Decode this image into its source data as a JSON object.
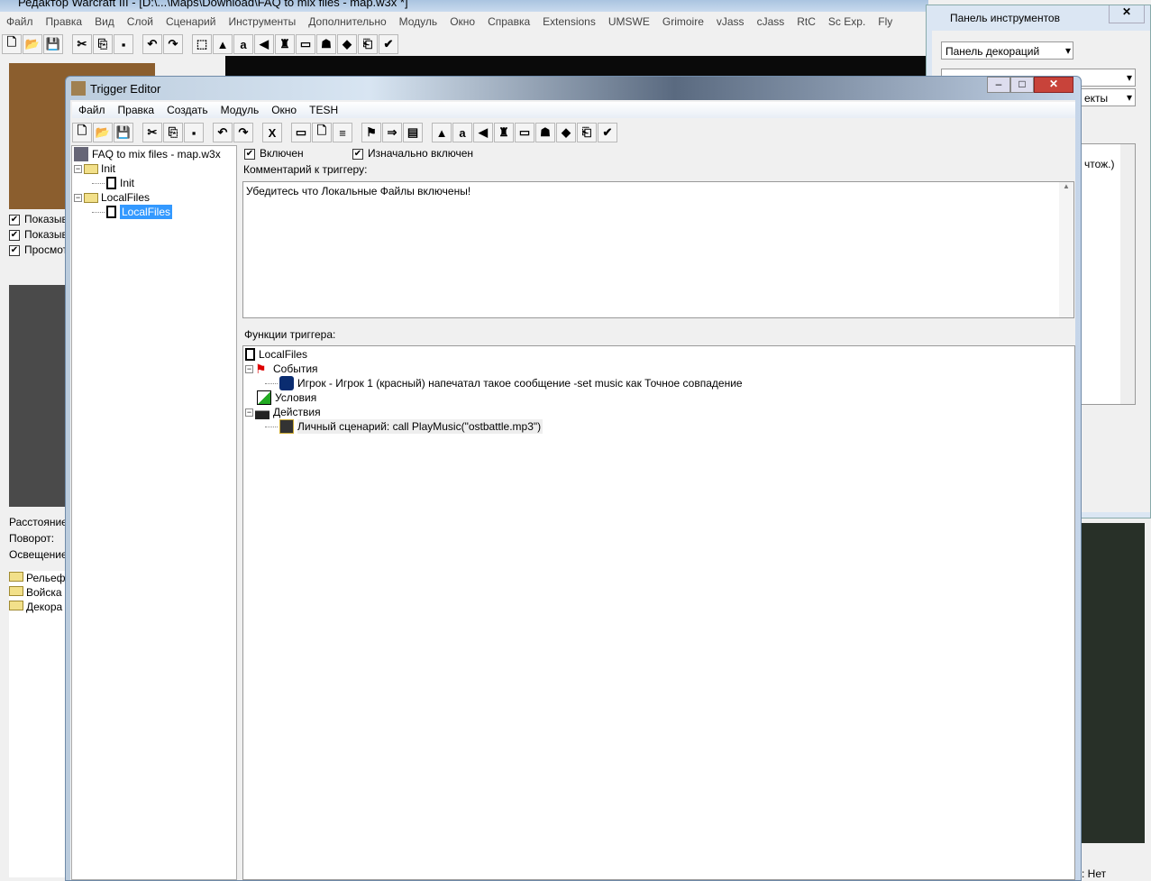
{
  "main_window": {
    "title": "Редактор Warcraft III  - [D:\\...\\Maps\\Download\\FAQ to mix files - map.w3x *]",
    "menu": [
      "Файл",
      "Правка",
      "Вид",
      "Слой",
      "Сценарий",
      "Инструменты",
      "Дополнительно",
      "Модуль",
      "Окно",
      "Справка",
      "Extensions",
      "UMSWE",
      "Grimoire",
      "vJass",
      "cJass",
      "RtC",
      "Sc Exp.",
      "Fly"
    ],
    "toolbar": [
      "new-icon",
      "open-icon",
      "save-icon",
      "cut-icon",
      "copy-icon",
      "paste-icon",
      "undo-icon",
      "redo-icon",
      "select-icon",
      "terrain-icon",
      "units-icon",
      "sound-icon",
      "doodads-icon",
      "object-editor-icon",
      "ai-editor-icon",
      "import-icon",
      "test-map-icon",
      "checkmark-icon"
    ],
    "left_panel": {
      "checkboxes": [
        {
          "label": "Показыв",
          "checked": true
        },
        {
          "label": "Показыв",
          "checked": true
        },
        {
          "label": "Просмот",
          "checked": true
        }
      ],
      "labels": [
        "Расстояние",
        "Поворот:",
        "Освещение"
      ],
      "tree": [
        "Рельеф",
        "Войска",
        "Декора"
      ]
    },
    "status": ": Нет"
  },
  "tool_palette": {
    "title": "Панель инструментов",
    "dropdown": "Панель декораций",
    "dropdown2": "",
    "dropdown3": "екты",
    "list_text": "чтож.)"
  },
  "trigger_editor": {
    "title": "Trigger Editor",
    "menu": [
      "Файл",
      "Правка",
      "Создать",
      "Модуль",
      "Окно",
      "TESH"
    ],
    "toolbar": [
      "new-icon",
      "open-icon",
      "save-icon",
      "cut-icon",
      "copy-icon",
      "paste-icon",
      "undo-icon",
      "redo-icon",
      "close-x-icon",
      "new-category-icon",
      "new-trigger-icon",
      "new-comment-icon",
      "new-event-icon",
      "new-condition-icon",
      "new-action-icon",
      "terrain-icon",
      "units-icon",
      "sound-icon",
      "doodads-icon",
      "object-editor-icon",
      "ai-editor-icon",
      "import-icon",
      "test-map-icon",
      "checkmark-icon"
    ],
    "tree": {
      "root": "FAQ to mix files - map.w3x",
      "items": [
        {
          "category": "Init",
          "triggers": [
            "Init"
          ]
        },
        {
          "category": "LocalFiles",
          "triggers": [
            "LocalFiles"
          ]
        }
      ],
      "selected": "LocalFiles"
    },
    "enabled_label": "Включен",
    "enabled": true,
    "initially_on_label": "Изначально включен",
    "initially_on": true,
    "comment_label": "Комментарий к триггеру:",
    "comment": "Убедитесь что Локальные Файлы включены!",
    "functions_label": "Функции триггера:",
    "functions": {
      "name": "LocalFiles",
      "events_label": "События",
      "event": "Игрок - Игрок 1 (красный) напечатал такое сообщение -set music как Точное совпадение",
      "conditions_label": "Условия",
      "actions_label": "Действия",
      "action": "Личный сценарий:   call PlayMusic(\"ostbattle.mp3\")"
    }
  }
}
